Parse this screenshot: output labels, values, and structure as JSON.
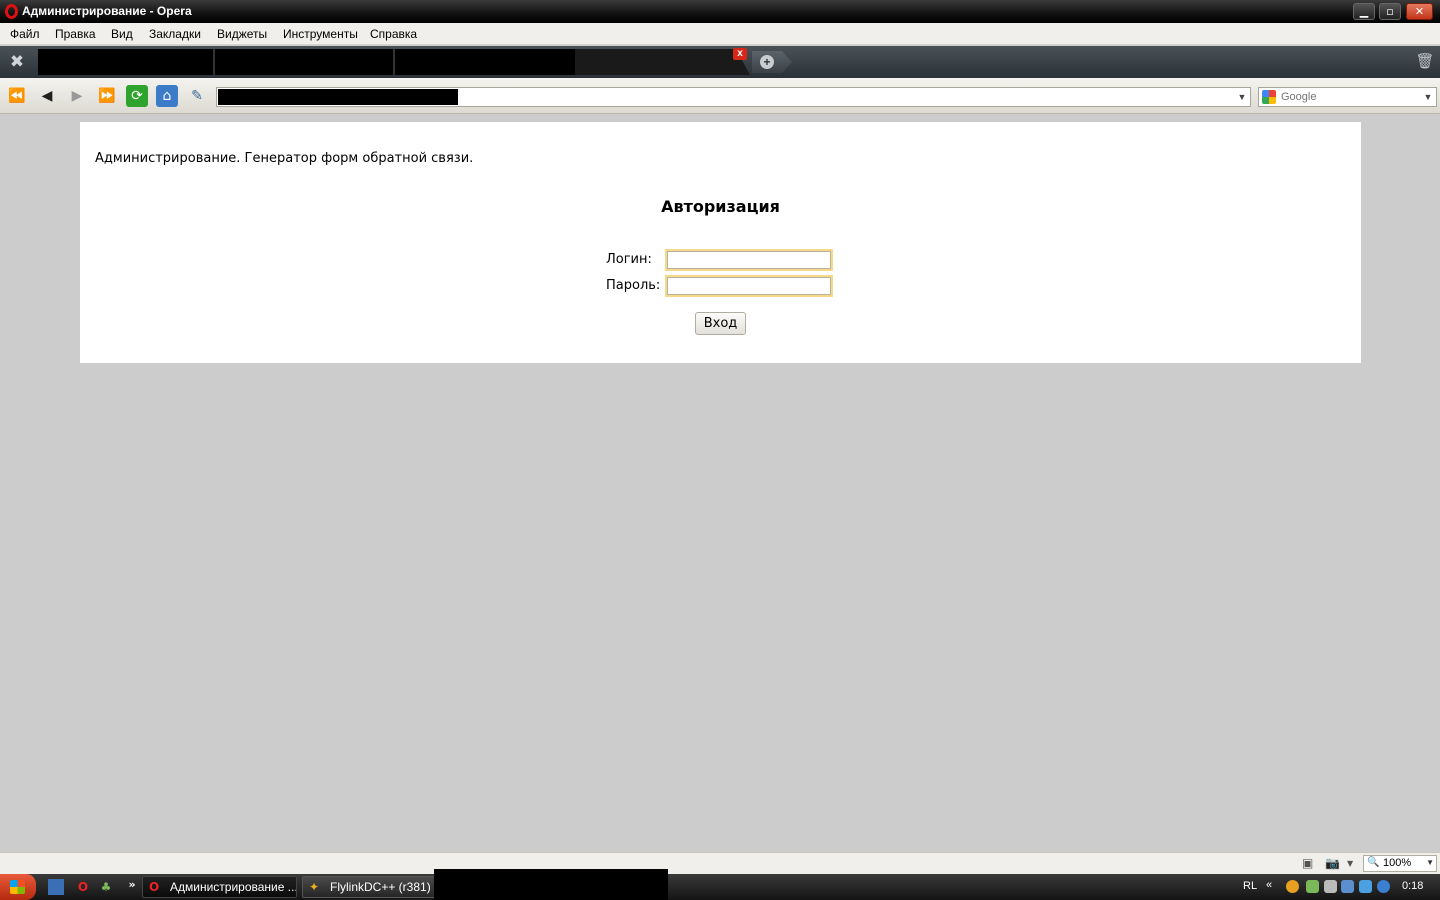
{
  "window": {
    "title": "Администрирование - Opera",
    "minimize_glyph": "▁",
    "maximize_glyph": "▫",
    "close_glyph": "✕"
  },
  "menu": [
    "Файл",
    "Правка",
    "Вид",
    "Закладки",
    "Виджеты",
    "Инструменты",
    "Справка"
  ],
  "tabbar": {
    "close_tab_glyph": "x",
    "new_tab_glyph": "+",
    "tools_glyph": "✖",
    "trash_glyph": "🗑"
  },
  "navbar": {
    "rewind_glyph": "⏪",
    "back_glyph": "◀",
    "forward_glyph": "▶",
    "fastforward_glyph": "⏩",
    "reload_glyph": "⟳",
    "home_glyph": "⌂",
    "edit_glyph": "✎",
    "search_placeholder": "Google",
    "dropdown_glyph": "▼"
  },
  "page": {
    "site_title": "Администрирование. Генератор форм обратной связи.",
    "heading": "Авторизация",
    "login_label": "Логин:",
    "password_label": "Пароль:",
    "login_value": "",
    "password_value": "",
    "submit_label": "Вход"
  },
  "statusbar": {
    "zoom": "100%",
    "zoom_glyph": "🔍",
    "dropdown_glyph": "▼",
    "icon1": "▣",
    "icon2": "📷"
  },
  "taskbar": {
    "tasks": [
      {
        "label": "Администрирование ...",
        "icon": "O"
      },
      {
        "label": "FlylinkDC++ (r381) - [",
        "icon": "✦"
      }
    ],
    "lang": "RL",
    "expand_glyph": "«",
    "more_glyph": "»",
    "clock": "0:18"
  },
  "colors": {
    "page_background": "#cccccc",
    "input_focus_border": "#f5d889",
    "close_button": "#c2351a"
  }
}
